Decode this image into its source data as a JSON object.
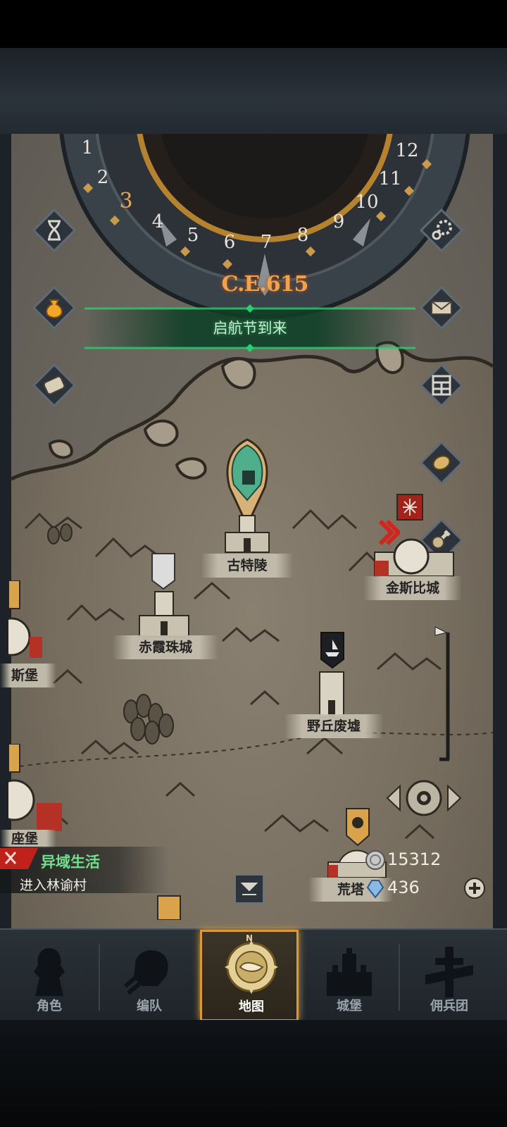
{
  "calendar": {
    "year": "C.E.615",
    "months": [
      "1",
      "2",
      "3",
      "4",
      "5",
      "6",
      "7",
      "8",
      "9",
      "10",
      "11",
      "12"
    ],
    "current_month": "3"
  },
  "banner": {
    "text": "启航节到来"
  },
  "left_buttons": [
    {
      "name": "hourglass-icon"
    },
    {
      "name": "coin-bag-icon"
    },
    {
      "name": "scroll-icon"
    }
  ],
  "right_buttons": [
    {
      "name": "gear-icon"
    },
    {
      "name": "mail-icon"
    },
    {
      "name": "grid-icon"
    },
    {
      "name": "coin-stack-icon"
    },
    {
      "name": "battle-icon"
    }
  ],
  "cities": {
    "gutelin": "古特陵",
    "jinsibi": "金斯比城",
    "chixia": "赤霞珠城",
    "yeqiu": "野丘废墟",
    "left_partial_1": "斯堡",
    "left_partial_2": "座堡",
    "huangta": "荒塔"
  },
  "event": {
    "title": "异域生活",
    "subtitle": "进入林谕村"
  },
  "resources": {
    "silver": "15312",
    "crystal": "436"
  },
  "nav": {
    "items": [
      {
        "label": "角色"
      },
      {
        "label": "编队"
      },
      {
        "label": "地图"
      },
      {
        "label": "城堡"
      },
      {
        "label": "佣兵团"
      }
    ],
    "active_index": 2,
    "compass_letter": "N"
  },
  "colors": {
    "accent": "#d99a35",
    "banner_glow": "#1fa85a",
    "year": "#f0a34a",
    "event_title": "#6fe08c"
  }
}
